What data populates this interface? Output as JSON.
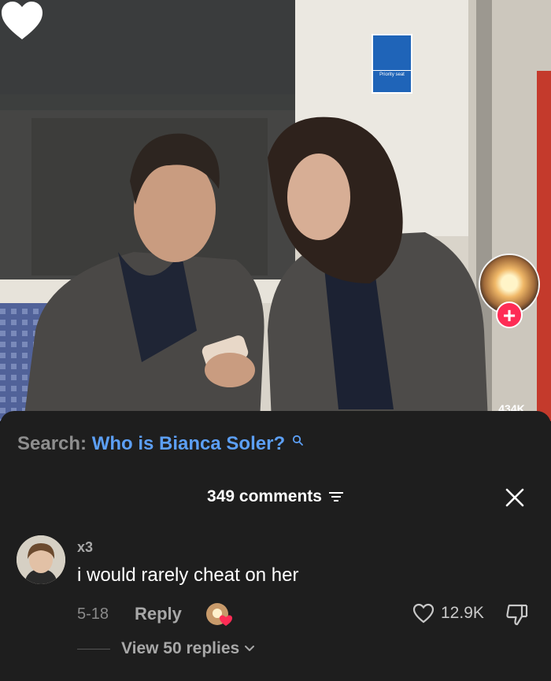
{
  "video": {
    "sign_title": "Priority seat",
    "side_like_count": "434K"
  },
  "search": {
    "prefix": "Search:",
    "query": "Who is Bianca Soler?"
  },
  "sheet": {
    "comments_count": "349 comments"
  },
  "comment": {
    "username": "x3",
    "text": "i would rarely cheat on her",
    "date": "5-18",
    "reply_label": "Reply",
    "like_count": "12.9K",
    "view_replies": "View 50 replies"
  },
  "colors": {
    "accent_red": "#fe2c55",
    "link_blue": "#5c9ff5",
    "sheet_bg": "#1e1e1e"
  }
}
